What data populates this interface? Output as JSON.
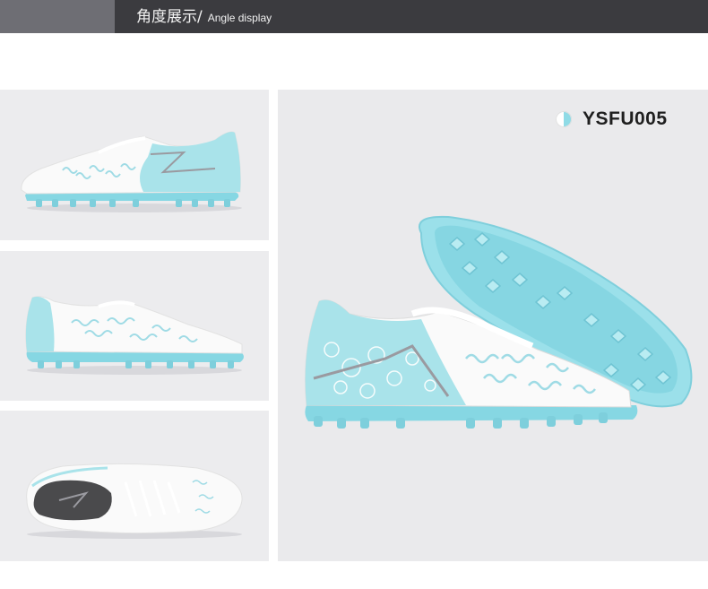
{
  "header": {
    "title_cn": "角度展示",
    "separator": "/",
    "title_en": "Angle display",
    "colors": {
      "bar": "#3b3b3f",
      "accent": "#6e6e74",
      "text": "#f2f2f2"
    }
  },
  "product": {
    "model": "YSFU005",
    "model_icon": "half-circle-icon",
    "colors": {
      "upper": "#ffffff",
      "accent": "#8fdbe6",
      "sole": "#7fd3e0"
    }
  },
  "gallery": {
    "views": [
      {
        "name": "lateral-side-view"
      },
      {
        "name": "medial-side-view"
      },
      {
        "name": "top-view"
      },
      {
        "name": "main-sole-and-side-view"
      }
    ]
  }
}
